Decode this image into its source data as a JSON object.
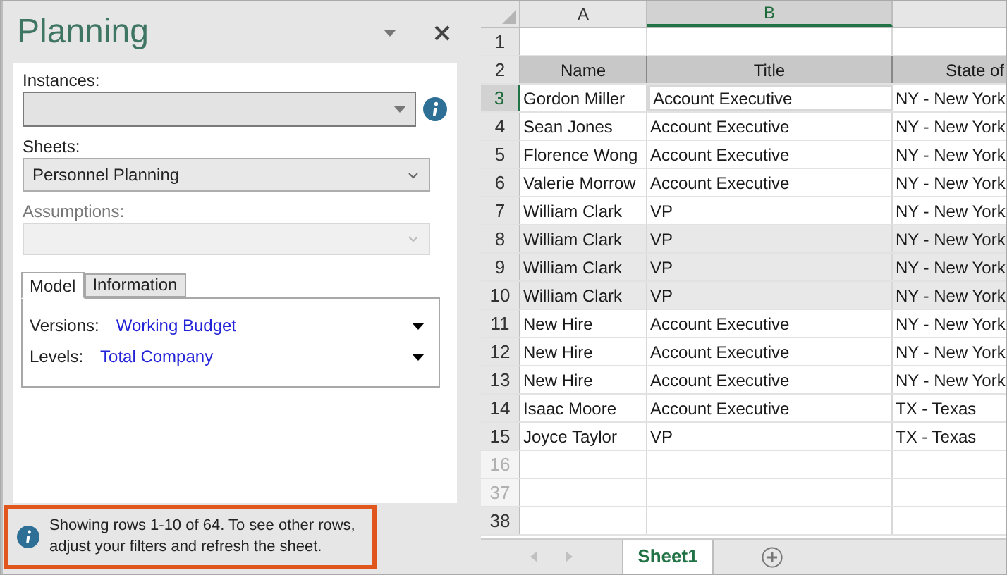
{
  "pane": {
    "title": "Planning",
    "instances": {
      "label": "Instances:"
    },
    "sheets": {
      "label": "Sheets:",
      "value": "Personnel Planning"
    },
    "assumptions": {
      "label": "Assumptions:",
      "disabled": true
    },
    "tabs": [
      {
        "label": "Model",
        "selected": true
      },
      {
        "label": "Information",
        "selected": false
      }
    ],
    "fields": [
      {
        "label": "Versions:",
        "value": "Working Budget"
      },
      {
        "label": "Levels:",
        "value": "Total Company"
      }
    ],
    "notice": "Showing rows 1-10 of 64. To see other rows, adjust your filters and refresh the sheet."
  },
  "sheet": {
    "columns": [
      {
        "label": "A",
        "selected": false
      },
      {
        "label": "B",
        "selected": true
      }
    ],
    "rows": [
      {
        "number": "1",
        "cells": [
          "",
          "",
          ""
        ],
        "header": false,
        "highlighted": false,
        "faded": false,
        "selected": false
      },
      {
        "number": "2",
        "cells": [
          "Name",
          "Title",
          "State of"
        ],
        "header": true,
        "highlighted": false,
        "faded": false,
        "selected": false
      },
      {
        "number": "3",
        "cells": [
          "Gordon Miller",
          "Account Executive",
          "NY - New York"
        ],
        "header": false,
        "highlighted": false,
        "faded": false,
        "selected": true
      },
      {
        "number": "4",
        "cells": [
          "Sean Jones",
          "Account Executive",
          "NY - New York"
        ],
        "header": false,
        "highlighted": false,
        "faded": false,
        "selected": false
      },
      {
        "number": "5",
        "cells": [
          "Florence Wong",
          "Account Executive",
          "NY - New York"
        ],
        "header": false,
        "highlighted": false,
        "faded": false,
        "selected": false
      },
      {
        "number": "6",
        "cells": [
          "Valerie Morrow",
          "Account Executive",
          "NY - New York"
        ],
        "header": false,
        "highlighted": false,
        "faded": false,
        "selected": false
      },
      {
        "number": "7",
        "cells": [
          "William Clark",
          "VP",
          "NY - New York"
        ],
        "header": false,
        "highlighted": false,
        "faded": false,
        "selected": false
      },
      {
        "number": "8",
        "cells": [
          "William Clark",
          "VP",
          "NY - New York"
        ],
        "header": false,
        "highlighted": true,
        "faded": false,
        "selected": false
      },
      {
        "number": "9",
        "cells": [
          "William Clark",
          "VP",
          "NY - New York"
        ],
        "header": false,
        "highlighted": true,
        "faded": false,
        "selected": false
      },
      {
        "number": "10",
        "cells": [
          "William Clark",
          "VP",
          "NY - New York"
        ],
        "header": false,
        "highlighted": true,
        "faded": false,
        "selected": false
      },
      {
        "number": "11",
        "cells": [
          "New Hire",
          "Account Executive",
          "NY - New York"
        ],
        "header": false,
        "highlighted": false,
        "faded": false,
        "selected": false
      },
      {
        "number": "12",
        "cells": [
          "New Hire",
          "Account Executive",
          "NY - New York"
        ],
        "header": false,
        "highlighted": false,
        "faded": false,
        "selected": false
      },
      {
        "number": "13",
        "cells": [
          "New Hire",
          "Account Executive",
          "NY - New York"
        ],
        "header": false,
        "highlighted": false,
        "faded": false,
        "selected": false
      },
      {
        "number": "14",
        "cells": [
          "Isaac Moore",
          "Account Executive",
          "TX - Texas"
        ],
        "header": false,
        "highlighted": false,
        "faded": false,
        "selected": false
      },
      {
        "number": "15",
        "cells": [
          "Joyce Taylor",
          "VP",
          "TX - Texas"
        ],
        "header": false,
        "highlighted": false,
        "faded": false,
        "selected": false
      },
      {
        "number": "16",
        "cells": [
          "",
          "",
          ""
        ],
        "header": false,
        "highlighted": false,
        "faded": true,
        "selected": false
      },
      {
        "number": "37",
        "cells": [
          "",
          "",
          ""
        ],
        "header": false,
        "highlighted": false,
        "faded": true,
        "selected": false
      },
      {
        "number": "38",
        "cells": [
          "",
          "",
          ""
        ],
        "header": false,
        "highlighted": false,
        "faded": false,
        "selected": false
      }
    ],
    "sheet_tabs": [
      {
        "label": "Sheet1",
        "selected": true
      }
    ]
  }
}
